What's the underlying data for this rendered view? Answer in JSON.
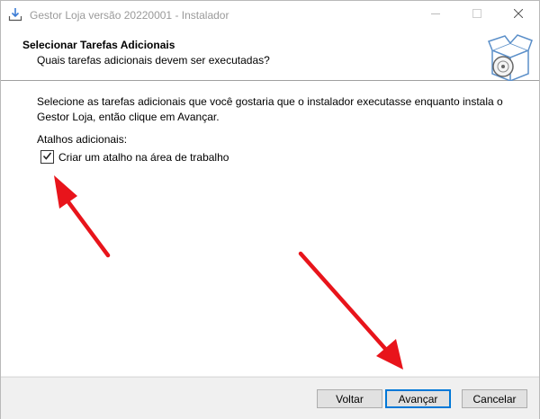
{
  "window": {
    "title": "Gestor Loja versão 20220001 - Instalador"
  },
  "header": {
    "title": "Selecionar Tarefas Adicionais",
    "subtitle": "Quais tarefas adicionais devem ser executadas?"
  },
  "body": {
    "description": "Selecione as tarefas adicionais que você gostaria que o instalador executasse enquanto instala o Gestor Loja, então clique em Avançar.",
    "group_label": "Atalhos adicionais:",
    "tasks": [
      {
        "label": "Criar um atalho na área de trabalho",
        "checked": true
      }
    ]
  },
  "footer": {
    "back_label": "Voltar",
    "next_label": "Avançar",
    "cancel_label": "Cancelar"
  },
  "colors": {
    "accent": "#0078d7",
    "annotation_arrow": "#e8141b"
  },
  "icons": [
    "installer-download-icon",
    "minimize-icon",
    "maximize-icon",
    "close-icon",
    "setup-box-disc-icon",
    "checkmark-icon"
  ]
}
